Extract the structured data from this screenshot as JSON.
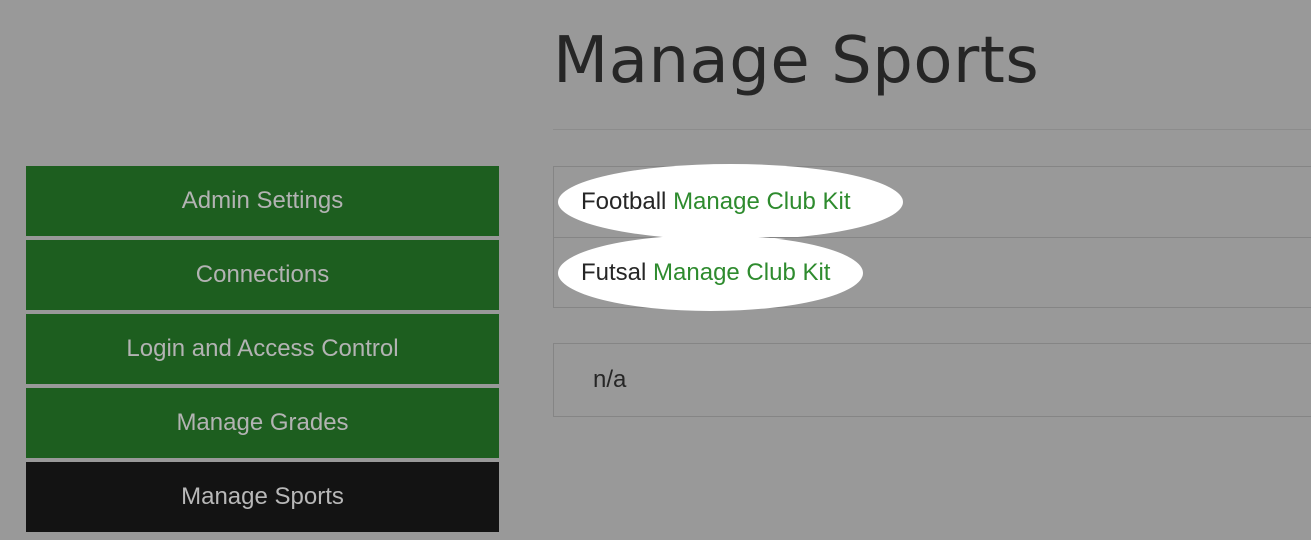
{
  "page": {
    "title": "Manage Sports"
  },
  "sidebar": {
    "items": [
      {
        "label": "Admin Settings"
      },
      {
        "label": "Connections"
      },
      {
        "label": "Login and Access Control"
      },
      {
        "label": "Manage Grades"
      },
      {
        "label": "Manage Sports",
        "active": true
      }
    ]
  },
  "sports": [
    {
      "name": "Football",
      "link": "Manage Club Kit"
    },
    {
      "name": "Futsal",
      "link": "Manage Club Kit"
    }
  ],
  "empty_box": {
    "text": "n/a"
  },
  "colors": {
    "background": "#999999",
    "sidebar_item": "#1d5e1f",
    "sidebar_active": "#131313",
    "link": "#2e8b2e",
    "highlight": "#ffffff"
  }
}
